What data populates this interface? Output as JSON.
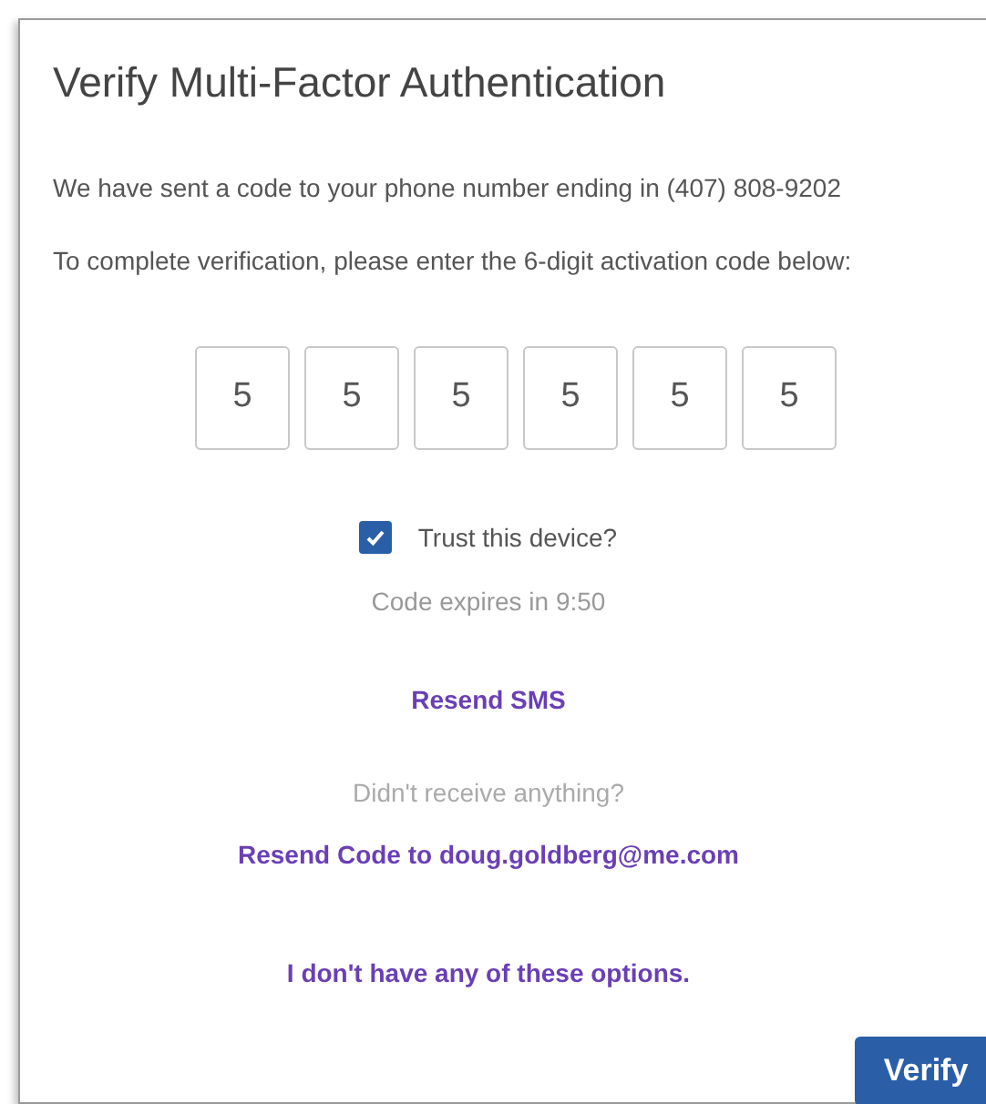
{
  "dialog": {
    "title": "Verify Multi-Factor Authentication",
    "messages": [
      "We have sent a code to your phone number ending in (407) 808-9202",
      "To complete verification, please enter the 6-digit activation code below:"
    ],
    "code_digits": [
      "5",
      "5",
      "5",
      "5",
      "5",
      "5"
    ],
    "trust_device": {
      "label": "Trust this device?",
      "checked": true
    },
    "expiry": "Code expires in 9:50",
    "resend_sms": "Resend SMS",
    "no_receive": "Didn't receive anything?",
    "resend_email": "Resend Code to doug.goldberg@me.com",
    "no_options": "I don't have any of these options.",
    "verify_button": "Verify"
  }
}
